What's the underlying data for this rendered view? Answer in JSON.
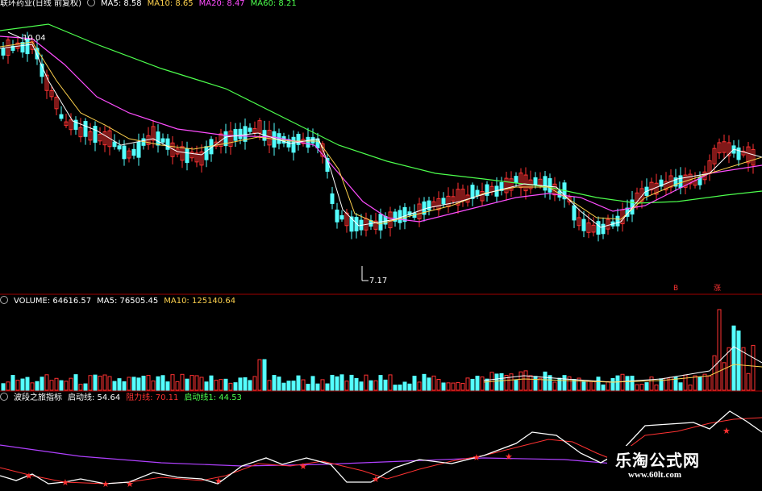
{
  "price_panel": {
    "stock_name": "联环药业(日线 前复权)",
    "ma5_label": "MA5: 8.58",
    "ma10_label": "MA10: 8.65",
    "ma20_label": "MA20: 8.47",
    "ma60_label": "MA60: 8.21",
    "high_price_label": "10.04",
    "low_price_label": "7.17",
    "marker_b": "B",
    "marker_zhang": "涨"
  },
  "volume_panel": {
    "volume_label": "VOLUME: 64616.57",
    "ma5_label": "MA5: 76505.45",
    "ma10_label": "MA10: 125140.64"
  },
  "indicator_panel": {
    "indicator_name": "波段之旅指标",
    "qidong_label": "启动线: 54.64",
    "zuli_label": "阻力线: 70.11",
    "qidong1_label": "启动线1: 44.53"
  },
  "watermark": {
    "title": "乐淘公式网",
    "url": "www.60lt.com"
  },
  "colors": {
    "bull": "#ff3232",
    "bear": "#54ffff",
    "ma5": "#ffffff",
    "ma10": "#ffd24d",
    "ma20": "#ff4dff",
    "ma60": "#4dff4d",
    "divider": "#a00000",
    "qidong": "#ffffff",
    "zuli": "#ff3232",
    "qidong1": "#b040ff"
  }
}
